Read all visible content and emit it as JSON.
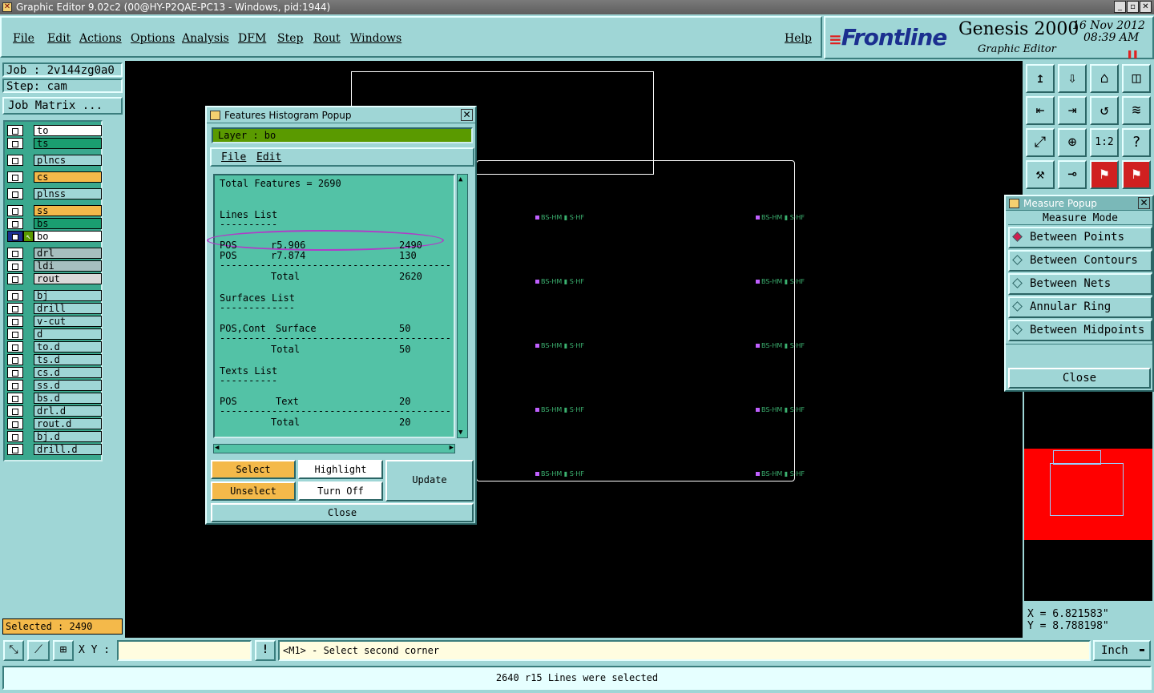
{
  "window": {
    "title": "Graphic Editor 9.02c2 (00@HY-P2QAE-PC13 - Windows, pid:1944)"
  },
  "menu": [
    "File",
    "Edit",
    "Actions",
    "Options",
    "Analysis",
    "DFM",
    "Step",
    "Rout",
    "Windows"
  ],
  "help": "Help",
  "brand": {
    "logo": "Frontline",
    "product": "Genesis 2000",
    "subtitle": "Graphic Editor",
    "date": "16 Nov 2012",
    "time": "08:39 AM"
  },
  "job": {
    "job_label": "Job : 2v144zg0a0",
    "step_label": "Step: cam",
    "matrix_button": "Job Matrix ..."
  },
  "layers": [
    {
      "name": "to",
      "color": "#ffffff"
    },
    {
      "name": "ts",
      "color": "#1a9e70"
    },
    {
      "name": "plncs",
      "color": "#9fd6d6"
    },
    {
      "name": "cs",
      "color": "#f4b94a"
    },
    {
      "name": "plnss",
      "color": "#9fd6d6"
    },
    {
      "name": "ss",
      "color": "#f4b94a"
    },
    {
      "name": "bs",
      "color": "#1a9e70"
    },
    {
      "name": "bo",
      "color": "#ffffff"
    },
    {
      "name": "drl",
      "color": "#a6bfbf"
    },
    {
      "name": "ldi",
      "color": "#a6bfbf"
    },
    {
      "name": "rout",
      "color": "#d9d9d9"
    },
    {
      "name": "bj",
      "color": "#9fd6d6"
    },
    {
      "name": "drill",
      "color": "#9fd6d6"
    },
    {
      "name": "v-cut",
      "color": "#9fd6d6"
    },
    {
      "name": "d",
      "color": "#9fd6d6"
    },
    {
      "name": "to.d",
      "color": "#9fd6d6"
    },
    {
      "name": "ts.d",
      "color": "#9fd6d6"
    },
    {
      "name": "cs.d",
      "color": "#9fd6d6"
    },
    {
      "name": "ss.d",
      "color": "#9fd6d6"
    },
    {
      "name": "bs.d",
      "color": "#9fd6d6"
    },
    {
      "name": "drl.d",
      "color": "#9fd6d6"
    },
    {
      "name": "rout.d",
      "color": "#9fd6d6"
    },
    {
      "name": "bj.d",
      "color": "#9fd6d6"
    },
    {
      "name": "drill.d",
      "color": "#9fd6d6"
    }
  ],
  "selected": "Selected : 2490",
  "histogram": {
    "title": "Features Histogram Popup",
    "layer_label": "Layer :  bo",
    "menu": [
      "File",
      "Edit"
    ],
    "total": "Total Features = 2690",
    "lines_title": "Lines List",
    "lines": [
      {
        "pol": "POS",
        "sym": "r5.906",
        "count": "2490"
      },
      {
        "pol": "POS",
        "sym": "r7.874",
        "count": "130"
      }
    ],
    "lines_total_label": "Total",
    "lines_total": "2620",
    "surfaces_title": "Surfaces List",
    "surfaces": [
      {
        "pol": "POS,Cont",
        "sym": "Surface",
        "count": "50"
      }
    ],
    "surfaces_total_label": "Total",
    "surfaces_total": "50",
    "texts_title": "Texts List",
    "texts": [
      {
        "pol": "POS",
        "sym": "Text",
        "count": "20"
      }
    ],
    "texts_total_label": "Total",
    "texts_total": "20",
    "buttons": {
      "select": "Select",
      "highlight": "Highlight",
      "update": "Update",
      "unselect": "Unselect",
      "turn_off": "Turn Off",
      "close": "Close"
    }
  },
  "measure": {
    "title": "Measure Popup",
    "mode_label": "Measure Mode",
    "options": [
      "Between Points",
      "Between Contours",
      "Between Nets",
      "Annular Ring",
      "Between Midpoints"
    ],
    "selected": "Between Points",
    "close": "Close"
  },
  "tools": [
    "↥",
    "⇩",
    "⌂",
    "◫",
    "⇤",
    "⇥",
    "↺",
    "≋",
    "⤢",
    "⊕",
    "1:2",
    "?",
    "⚒",
    "⊸",
    "⚑",
    "⚑"
  ],
  "coords": {
    "x": "X = 6.821583\"",
    "y": "Y = 8.788198\""
  },
  "bottom": {
    "xy_label": "X Y :",
    "xy_value": "",
    "prompt": "<M1> - Select second corner",
    "unit": "Inch"
  },
  "status": "2640 r15 Lines were selected",
  "pcb_mark": "BS-HM ▮ S·HF"
}
